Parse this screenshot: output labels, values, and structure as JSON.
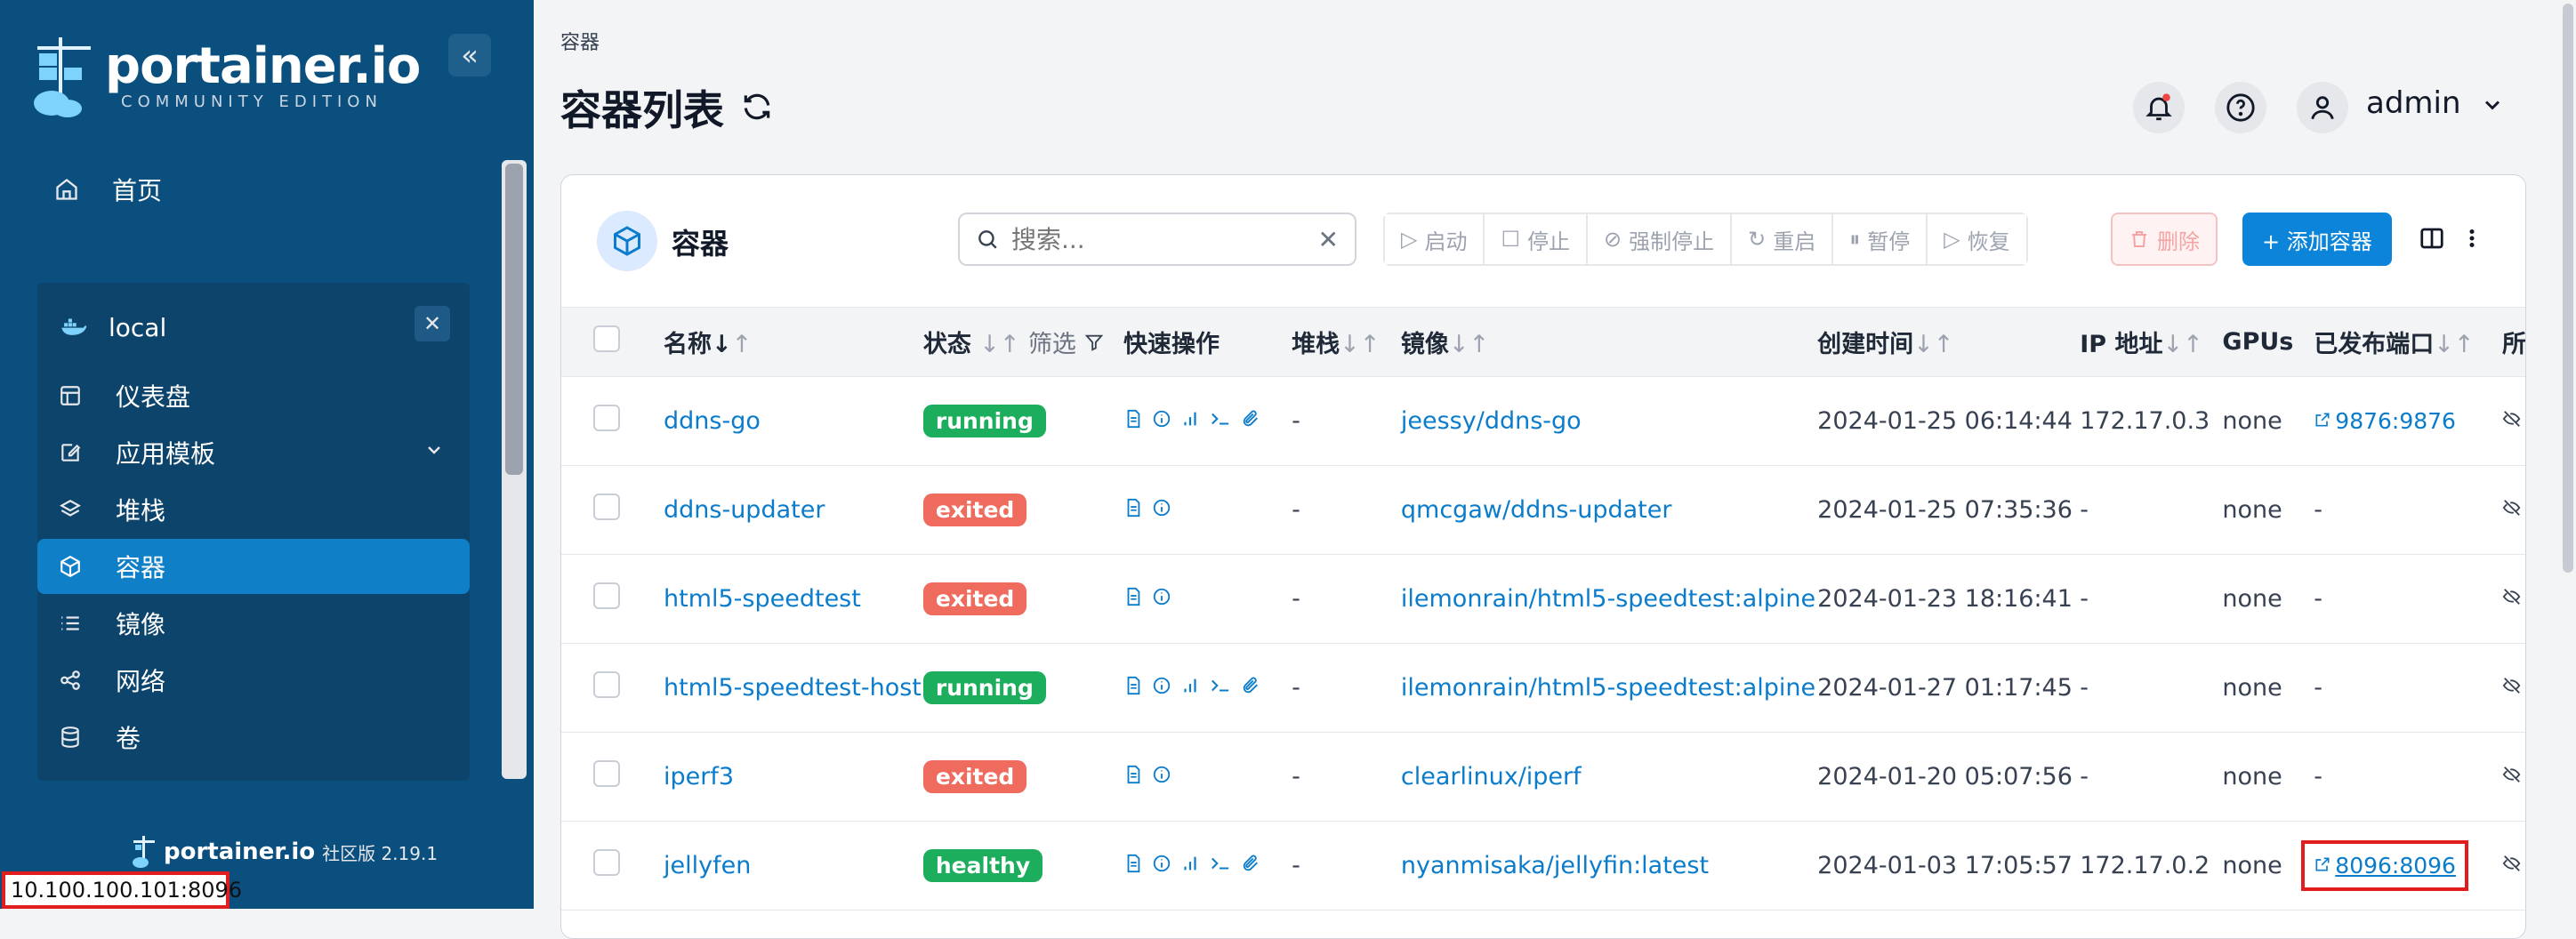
{
  "sidebar": {
    "logo_text": "portainer.io",
    "logo_subtitle": "COMMUNITY EDITION",
    "collapse_glyph": "«",
    "home_label": "首页",
    "env_name": "local",
    "env_close_glyph": "✕",
    "items": [
      {
        "label": "仪表盘",
        "icon": "dashboard-icon"
      },
      {
        "label": "应用模板",
        "icon": "edit-icon",
        "has_chevron": true
      },
      {
        "label": "堆栈",
        "icon": "layers-icon"
      },
      {
        "label": "容器",
        "icon": "cube-icon",
        "active": true
      },
      {
        "label": "镜像",
        "icon": "list-icon"
      },
      {
        "label": "网络",
        "icon": "share-icon"
      },
      {
        "label": "卷",
        "icon": "database-icon"
      }
    ],
    "footer_brand": "portainer.io",
    "footer_edition": "社区版 2.19.1",
    "status_url": "10.100.100.101:8096"
  },
  "header": {
    "breadcrumb": "容器",
    "title": "容器列表",
    "user": "admin"
  },
  "card": {
    "title": "容器",
    "search_placeholder": "搜索...",
    "toolbar": [
      {
        "label": "启动",
        "glyph": "▷"
      },
      {
        "label": "停止",
        "glyph": "☐"
      },
      {
        "label": "强制停止",
        "glyph": "⊘"
      },
      {
        "label": "重启",
        "glyph": "↻"
      },
      {
        "label": "暂停",
        "glyph": "⏸"
      },
      {
        "label": "恢复",
        "glyph": "▷"
      }
    ],
    "delete_label": "删除",
    "add_label": "+ 添加容器",
    "columns": {
      "name": "名称",
      "state": "状态",
      "filter": "筛选",
      "quick": "快速操作",
      "stack": "堆栈",
      "image": "镜像",
      "created": "创建时间",
      "ip": "IP 地址",
      "gpus": "GPUs",
      "ports": "已发布端口",
      "owner": "所"
    },
    "sort_glyph": "↓↑",
    "sort_active_glyph": "↓↑"
  },
  "rows": [
    {
      "name": "ddns-go",
      "state": "running",
      "stack": "-",
      "image": "jeessy/ddns-go",
      "created": "2024-01-25 06:14:44",
      "ip": "172.17.0.3",
      "gpus": "none",
      "port": "9876:9876"
    },
    {
      "name": "ddns-updater",
      "state": "exited",
      "stack": "-",
      "image": "qmcgaw/ddns-updater",
      "created": "2024-01-25 07:35:36",
      "ip": "-",
      "gpus": "none",
      "port": "-"
    },
    {
      "name": "html5-speedtest",
      "state": "exited",
      "stack": "-",
      "image": "ilemonrain/html5-speedtest:alpine",
      "created": "2024-01-23 18:16:41",
      "ip": "-",
      "gpus": "none",
      "port": "-"
    },
    {
      "name": "html5-speedtest-host",
      "state": "running",
      "stack": "-",
      "image": "ilemonrain/html5-speedtest:alpine",
      "created": "2024-01-27 01:17:45",
      "ip": "-",
      "gpus": "none",
      "port": "-"
    },
    {
      "name": "iperf3",
      "state": "exited",
      "stack": "-",
      "image": "clearlinux/iperf",
      "created": "2024-01-20 05:07:56",
      "ip": "-",
      "gpus": "none",
      "port": "-"
    },
    {
      "name": "jellyfen",
      "state": "healthy",
      "stack": "-",
      "image": "nyanmisaka/jellyfin:latest",
      "created": "2024-01-03 17:05:57",
      "ip": "172.17.0.2",
      "gpus": "none",
      "port": "8096:8096"
    }
  ]
}
